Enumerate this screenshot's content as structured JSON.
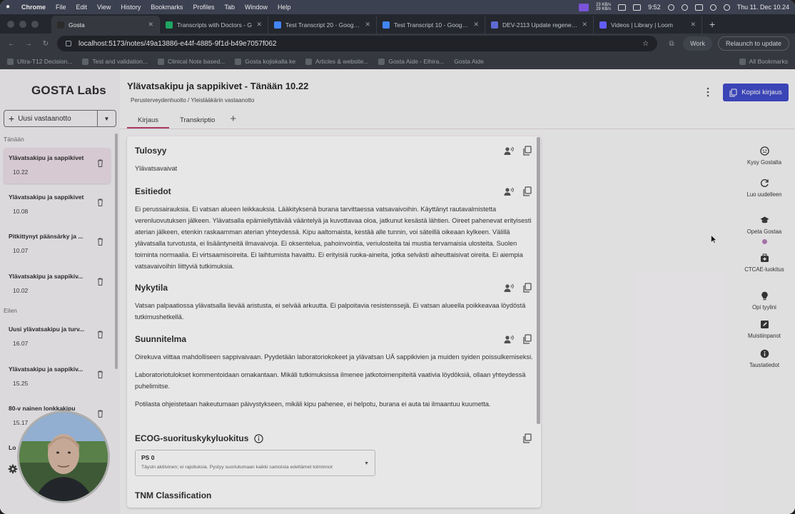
{
  "menubar": {
    "app": "Chrome",
    "items": [
      "File",
      "Edit",
      "View",
      "History",
      "Bookmarks",
      "Profiles",
      "Tab",
      "Window",
      "Help"
    ],
    "net_up": "23 KB/s",
    "net_down": "29 KB/s",
    "time": "9:52",
    "clock": "Thu 11. Dec 10.24"
  },
  "tabs": [
    {
      "title": "Gosta",
      "active": true
    },
    {
      "title": "Transcripts with Doctors - G"
    },
    {
      "title": "Test Transcript 20 - Google D"
    },
    {
      "title": "Test Transcript 10 - Google D"
    },
    {
      "title": "DEV-2113 Update regenerat"
    },
    {
      "title": "Videos | Library | Loom"
    }
  ],
  "addressbar": {
    "url": "localhost:5173/notes/49a13886-e44f-4885-9f1d-b49e7057f062",
    "profile": "Work",
    "update": "Relaunch to update"
  },
  "bookmarks": {
    "items": [
      "Ultra-T12 Decision...",
      "Test and validation...",
      "Clinical Note based...",
      "Gosta kojiskalla ke",
      "Articles & website...",
      "Gosta Aide - Elhira...",
      "Gosta Aide"
    ],
    "all": "All Bookmarks"
  },
  "sidebar": {
    "logo": "GOSTA Labs",
    "new_visit": "Uusi vastaanotto",
    "section_today": "Tänään",
    "section_yesterday": "Eilen",
    "today": [
      {
        "title": "Ylävatsakipu ja sappikivet",
        "time": "10.22"
      },
      {
        "title": "Ylävatsakipu ja sappikivet",
        "time": "10.08"
      },
      {
        "title": "Pitkittynyt päänsärky ja ...",
        "time": "10.07"
      },
      {
        "title": "Ylävatsakipu ja sappikiv...",
        "time": "10.02"
      }
    ],
    "yesterday": [
      {
        "title": "Uusi ylävatsakipu ja turv...",
        "time": "16.07"
      },
      {
        "title": "Ylävatsakipu ja sappikiv...",
        "time": "15.25"
      },
      {
        "title": "80-v nainen lonkkakipu",
        "time": "15.17"
      },
      {
        "title": "Lo",
        "time": ""
      }
    ]
  },
  "note": {
    "title": "Ylävatsakipu ja sappikivet - Tänään 10.22",
    "breadcrumb": "Perusterveydenhuolto / Yleislääkärin vastaanotto",
    "copy_button": "Kopioi kirjaus",
    "tabs": [
      "Kirjaus",
      "Transkriptio"
    ],
    "sections": [
      {
        "heading": "Tulosyy",
        "paragraphs": [
          "Ylävatsavaivat"
        ]
      },
      {
        "heading": "Esitiedot",
        "paragraphs": [
          "Ei perussairauksia. Ei vatsan alueen leikkauksia. Lääkityksenä burana tarvittaessa vatsavaivoihin. Käyttänyt rautavalmistetta verenluovutuksen jälkeen. Ylävatsalla epämiellyttävää vääntelyä ja kuvottavaa oloa, jatkunut kesästä lähtien. Oireet pahenevat erityisesti aterian jälkeen, etenkin raskaamman aterian yhteydessä. Kipu aaltomaista, kestää alle tunnin, voi säteillä oikeaan kylkeen. Välillä ylävatsalla turvotusta, ei lisääntyneitä ilmavaivoja. Ei oksentelua, pahoinvointia, veriulosteita tai mustia tervamaisia ulosteita. Suolen toiminta normaalia. Ei virtsaamisoireita. Ei laihtumista havaittu. Ei erityisiä ruoka-aineita, jotka selvästi aiheuttaisivat oireita. Ei aiempia vatsavaivoihin liittyviä tutkimuksia."
        ]
      },
      {
        "heading": "Nykytila",
        "paragraphs": [
          "Vatsan palpaatiossa ylävatsalla lievää aristusta, ei selvää arkuutta. Ei palpoitavia resistenssejä. Ei vatsan alueella poikkeavaa löydöstä tutkimushetkellä."
        ]
      },
      {
        "heading": "Suunnitelma",
        "paragraphs": [
          "Oirekuva viittaa mahdolliseen sappivaivaan. Pyydetään laboratoriokokeet ja ylävatsan UÄ sappikivien ja muiden syiden poissulkemiseksi.",
          "Laboratoriotulokset kommentoidaan omakantaan. Mikäli tutkimuksissa ilmenee jatkotoimenpiteitä vaativia löydöksiä, ollaan yhteydessä puhelimitse.",
          "Potilasta ohjeistetaan hakeutumaan päivystykseen, mikäli kipu pahenee, ei helpotu, burana ei auta tai ilmaantuu kuumetta."
        ]
      }
    ],
    "ecog": {
      "heading": "ECOG-suorituskykyluokitus",
      "value": "PS 0",
      "description": "Täysin aktiivinen; ei rajoituksia. Pystyy suoriutumaan kaikki samoista edeltämet toiminnot"
    },
    "tnm_heading": "TNM Classification"
  },
  "rail": [
    {
      "label": "Kysy Gostalta",
      "icon": "chat-face-icon"
    },
    {
      "label": "Luo uudelleen",
      "icon": "regenerate-icon"
    },
    {
      "label": "Opeta Gostaa",
      "icon": "graduation-cap-icon"
    },
    {
      "label": "CTCAE-luokitus",
      "icon": "medical-kit-icon"
    },
    {
      "label": "Opi tyylini",
      "icon": "lightbulb-icon"
    },
    {
      "label": "Muistiinpanot",
      "icon": "note-edit-icon"
    },
    {
      "label": "Taustatiedot",
      "icon": "info-icon"
    }
  ],
  "colors": {
    "accent": "#3c46c8",
    "tab_underline": "#b83a67",
    "selected_item": "#ecdde6"
  }
}
